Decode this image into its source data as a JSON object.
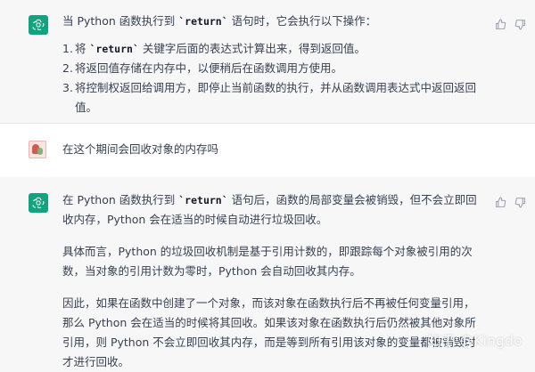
{
  "messages": [
    {
      "role": "assistant",
      "intro_pre": "当 Python 函数执行到 ",
      "intro_code": "`return`",
      "intro_post": " 语句时，它会执行以下操作：",
      "list": [
        {
          "num": "1.",
          "pre": "将 ",
          "code": "`return`",
          "post": " 关键字后面的表达式计算出来，得到返回值。"
        },
        {
          "num": "2.",
          "pre": "将返回值存储在内存中，以便稍后在函数调用方使用。",
          "code": "",
          "post": ""
        },
        {
          "num": "3.",
          "pre": "将控制权返回给调用方，即停止当前函数的执行，并从函数调用表达式中返回返回值。",
          "code": "",
          "post": ""
        }
      ]
    },
    {
      "role": "user",
      "text": "在这个期间会回收对象的内存吗"
    },
    {
      "role": "assistant",
      "p1_pre": "在 Python 函数执行到 ",
      "p1_code": "`return`",
      "p1_post": " 语句后，函数的局部变量会被销毁，但不会立即回收内存，Python 会在适当的时候自动进行垃圾回收。",
      "p2": "具体而言，Python 的垃圾回收机制是基于引用计数的，即跟踪每个对象被引用的次数，当对象的引用计数为零时，Python 会自动回收其内存。",
      "p3": "因此，如果在函数中创建了一个对象，而该对象在函数执行后不再被任何变量引用，那么 Python 会在适当的时候将其回收。如果该对象在函数执行后仍然被其他对象所引用，则 Python 不会立即回收其内存，而是等到所有引用该对象的变量都被销毁时才进行回收。"
    }
  ],
  "watermark": "知乎 @Kingdo",
  "colors": {
    "gpt_avatar": "#10a37f",
    "assistant_bg": "#f7f7f8",
    "user_bg": "#ffffff"
  },
  "icons": [
    "openai-logo-icon",
    "thumbs-up-icon",
    "thumbs-down-icon",
    "user-avatar"
  ]
}
